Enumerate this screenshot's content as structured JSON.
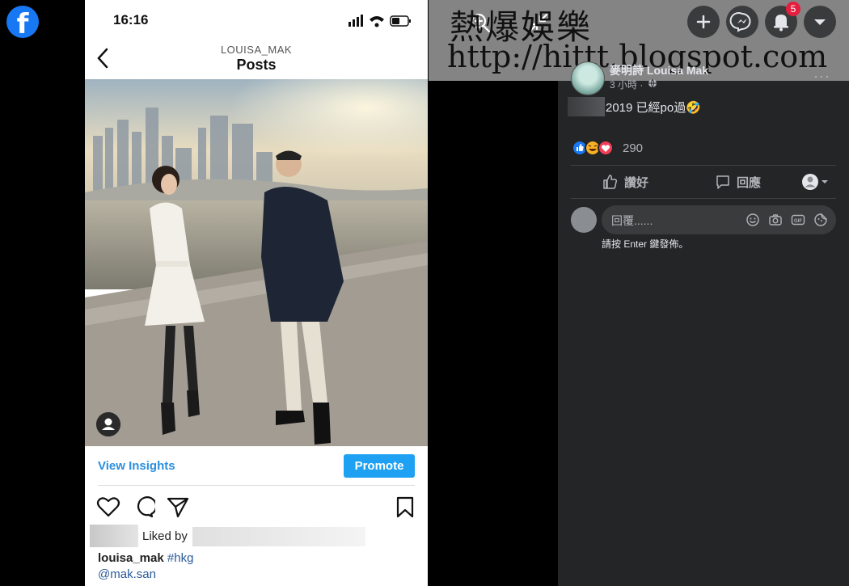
{
  "left": {
    "logo_letter": "f"
  },
  "phone": {
    "status_time": "16:16",
    "nav_username": "LOUISA_MAK",
    "nav_title": "Posts",
    "view_insights": "View Insights",
    "promote": "Promote",
    "liked_by_label": "Liked by",
    "caption_user": "louisa_mak",
    "caption_hashtag": "#hkg",
    "mention": "@mak.san"
  },
  "facebook": {
    "watermark_title": "熱爆娛樂",
    "watermark_url": "http://hittt.blogspot.com",
    "notification_count": "5",
    "author_name": "麥明詩 Louisa Mak",
    "post_time": "3 小時 ·",
    "post_options": "···",
    "post_text": "2019 已經po過🤣",
    "reaction_count": "290",
    "like_label": "讚好",
    "comment_label": "回應",
    "comment_placeholder": "回覆......",
    "enter_hint": "請按 Enter 鍵發佈。",
    "gif_label": "GIF"
  },
  "colors": {
    "fb_blue": "#1877f2",
    "ig_blue": "#1ea1f2",
    "dark_surface": "#242526",
    "notification_red": "#e41e3f"
  },
  "icons": [
    "facebook-logo-icon",
    "back-chevron-icon",
    "heart-icon",
    "comment-bubble-icon",
    "send-icon",
    "bookmark-icon",
    "plus-icon",
    "messenger-icon",
    "bell-icon",
    "caret-down-icon",
    "zoom-in-icon",
    "collapse-icon",
    "globe-icon",
    "like-reaction-icon",
    "haha-reaction-icon",
    "love-reaction-icon",
    "thumb-up-icon",
    "comment-icon",
    "smiley-icon",
    "camera-icon",
    "gif-icon",
    "sticker-icon"
  ]
}
